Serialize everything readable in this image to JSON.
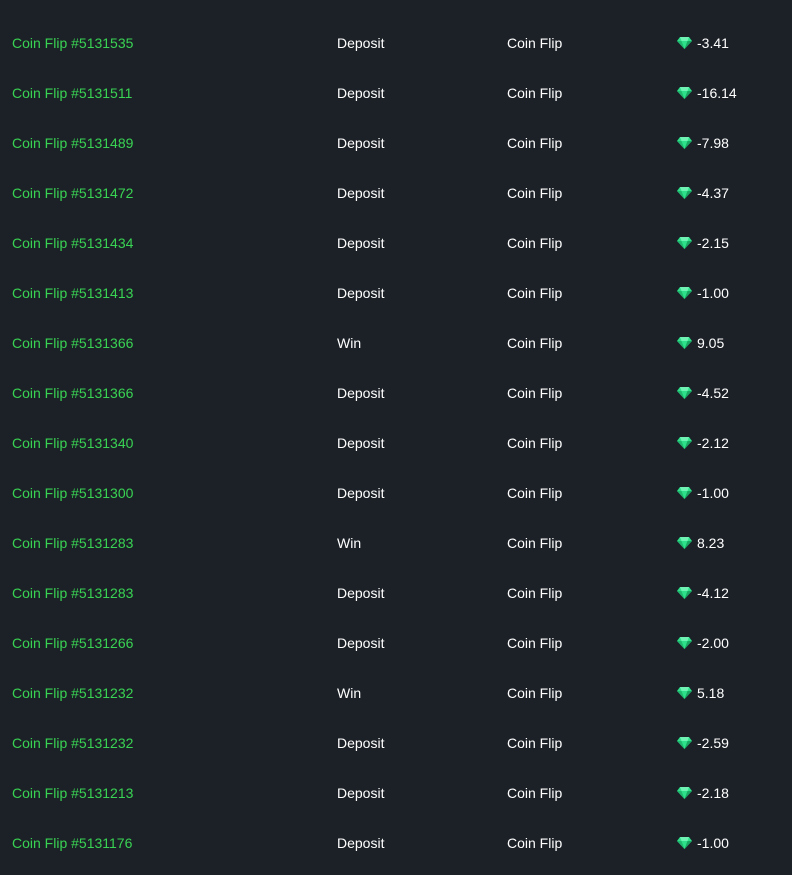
{
  "colors": {
    "background": "#1c2127",
    "link": "#39d353",
    "text": "#ffffff",
    "gem": "#2ee08a"
  },
  "amount_icon": "gem-icon",
  "rows": [
    {
      "name": "Coin Flip #5131535",
      "type": "Deposit",
      "game": "Coin Flip",
      "amount": "-3.41"
    },
    {
      "name": "Coin Flip #5131511",
      "type": "Deposit",
      "game": "Coin Flip",
      "amount": "-16.14"
    },
    {
      "name": "Coin Flip #5131489",
      "type": "Deposit",
      "game": "Coin Flip",
      "amount": "-7.98"
    },
    {
      "name": "Coin Flip #5131472",
      "type": "Deposit",
      "game": "Coin Flip",
      "amount": "-4.37"
    },
    {
      "name": "Coin Flip #5131434",
      "type": "Deposit",
      "game": "Coin Flip",
      "amount": "-2.15"
    },
    {
      "name": "Coin Flip #5131413",
      "type": "Deposit",
      "game": "Coin Flip",
      "amount": "-1.00"
    },
    {
      "name": "Coin Flip #5131366",
      "type": "Win",
      "game": "Coin Flip",
      "amount": "9.05"
    },
    {
      "name": "Coin Flip #5131366",
      "type": "Deposit",
      "game": "Coin Flip",
      "amount": "-4.52"
    },
    {
      "name": "Coin Flip #5131340",
      "type": "Deposit",
      "game": "Coin Flip",
      "amount": "-2.12"
    },
    {
      "name": "Coin Flip #5131300",
      "type": "Deposit",
      "game": "Coin Flip",
      "amount": "-1.00"
    },
    {
      "name": "Coin Flip #5131283",
      "type": "Win",
      "game": "Coin Flip",
      "amount": "8.23"
    },
    {
      "name": "Coin Flip #5131283",
      "type": "Deposit",
      "game": "Coin Flip",
      "amount": "-4.12"
    },
    {
      "name": "Coin Flip #5131266",
      "type": "Deposit",
      "game": "Coin Flip",
      "amount": "-2.00"
    },
    {
      "name": "Coin Flip #5131232",
      "type": "Win",
      "game": "Coin Flip",
      "amount": "5.18"
    },
    {
      "name": "Coin Flip #5131232",
      "type": "Deposit",
      "game": "Coin Flip",
      "amount": "-2.59"
    },
    {
      "name": "Coin Flip #5131213",
      "type": "Deposit",
      "game": "Coin Flip",
      "amount": "-2.18"
    },
    {
      "name": "Coin Flip #5131176",
      "type": "Deposit",
      "game": "Coin Flip",
      "amount": "-1.00"
    }
  ]
}
